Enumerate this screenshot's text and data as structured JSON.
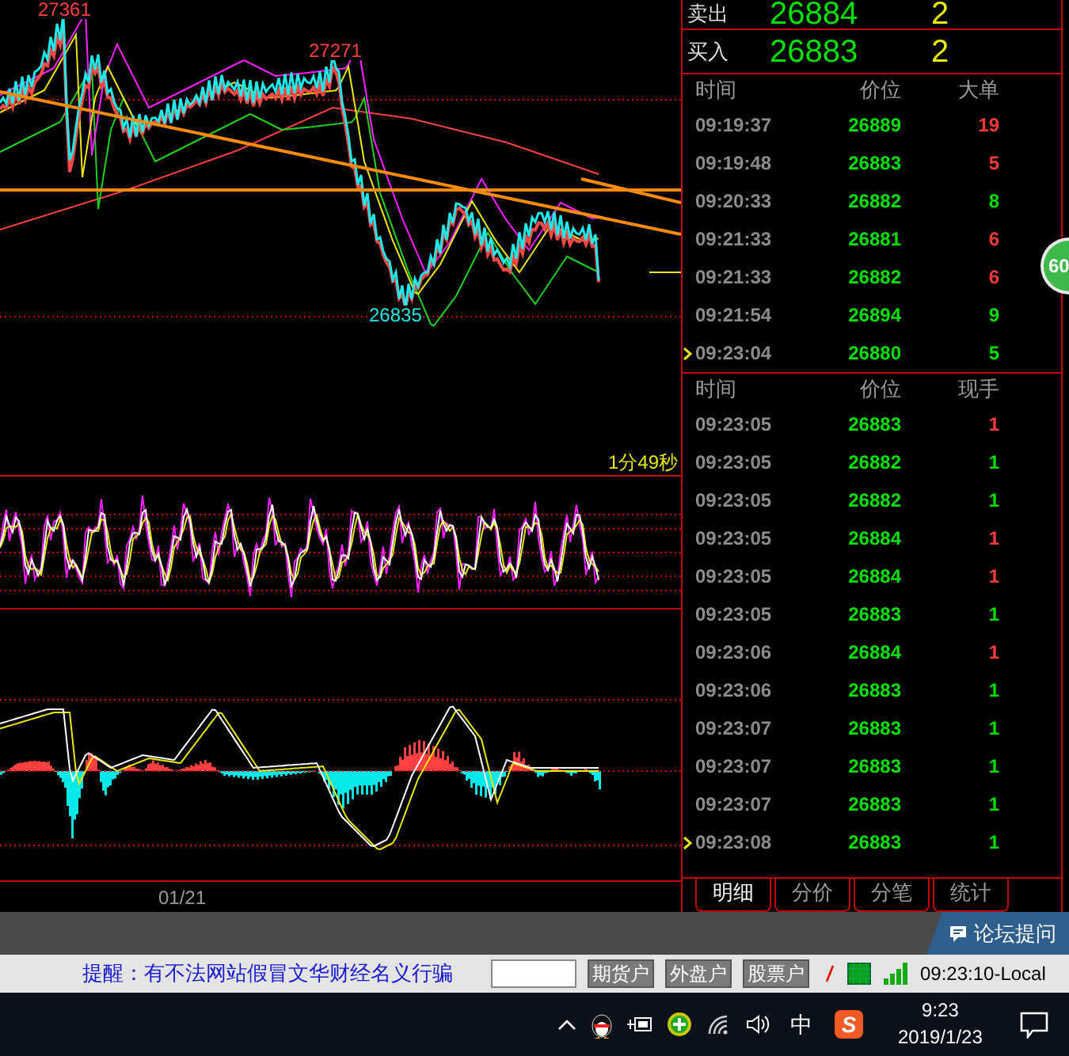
{
  "chart": {
    "labels": [
      {
        "kind": "high",
        "text": "27361"
      },
      {
        "kind": "peak",
        "text": "27271"
      },
      {
        "kind": "low",
        "text": "26835"
      }
    ],
    "timer": "1分49秒"
  },
  "date_label": "01/21",
  "quote": {
    "sell": {
      "label": "卖出",
      "price": "26884",
      "volume": "2"
    },
    "buy": {
      "label": "买入",
      "price": "26883",
      "volume": "2"
    }
  },
  "big_orders": {
    "columns": [
      "时间",
      "价位",
      "大单"
    ],
    "rows": [
      {
        "time": "09:19:37",
        "price": "26889",
        "quantity": "19",
        "color": "#ff3b3b",
        "marked": false
      },
      {
        "time": "09:19:48",
        "price": "26883",
        "quantity": "5",
        "color": "#ff3b3b",
        "marked": false
      },
      {
        "time": "09:20:33",
        "price": "26882",
        "quantity": "8",
        "color": "#00e000",
        "marked": false
      },
      {
        "time": "09:21:33",
        "price": "26881",
        "quantity": "6",
        "color": "#ff3b3b",
        "marked": false
      },
      {
        "time": "09:21:33",
        "price": "26882",
        "quantity": "6",
        "color": "#ff3b3b",
        "marked": false
      },
      {
        "time": "09:21:54",
        "price": "26894",
        "quantity": "9",
        "color": "#00e000",
        "marked": false
      },
      {
        "time": "09:23:04",
        "price": "26880",
        "quantity": "5",
        "color": "#00e000",
        "marked": true
      }
    ]
  },
  "ticks": {
    "columns": [
      "时间",
      "价位",
      "现手"
    ],
    "rows": [
      {
        "time": "09:23:05",
        "price": "26883",
        "quantity": "1",
        "color": "#ff3b3b",
        "marked": false
      },
      {
        "time": "09:23:05",
        "price": "26882",
        "quantity": "1",
        "color": "#00e000",
        "marked": false
      },
      {
        "time": "09:23:05",
        "price": "26882",
        "quantity": "1",
        "color": "#00e000",
        "marked": false
      },
      {
        "time": "09:23:05",
        "price": "26884",
        "quantity": "1",
        "color": "#ff3b3b",
        "marked": false
      },
      {
        "time": "09:23:05",
        "price": "26884",
        "quantity": "1",
        "color": "#ff3b3b",
        "marked": false
      },
      {
        "time": "09:23:05",
        "price": "26883",
        "quantity": "1",
        "color": "#00e000",
        "marked": false
      },
      {
        "time": "09:23:06",
        "price": "26884",
        "quantity": "1",
        "color": "#ff3b3b",
        "marked": false
      },
      {
        "time": "09:23:06",
        "price": "26883",
        "quantity": "1",
        "color": "#00e000",
        "marked": false
      },
      {
        "time": "09:23:07",
        "price": "26883",
        "quantity": "1",
        "color": "#00e000",
        "marked": false
      },
      {
        "time": "09:23:07",
        "price": "26883",
        "quantity": "1",
        "color": "#00e000",
        "marked": false
      },
      {
        "time": "09:23:07",
        "price": "26883",
        "quantity": "1",
        "color": "#00e000",
        "marked": false
      },
      {
        "time": "09:23:08",
        "price": "26883",
        "quantity": "1",
        "color": "#00e000",
        "marked": true
      }
    ]
  },
  "tabs": [
    {
      "label": "明细",
      "selected": true
    },
    {
      "label": "分价",
      "selected": false
    },
    {
      "label": "分笔",
      "selected": false
    },
    {
      "label": "统计",
      "selected": false
    }
  ],
  "badge": "60",
  "forum_button": "论坛提问",
  "status_bar": {
    "notice": "提醒：有不法网站假冒文华财经名义行骗",
    "buttons": [
      "期货户",
      "外盘户",
      "股票户"
    ],
    "time": "09:23:10-Local"
  },
  "taskbar": {
    "ime": "中",
    "ime_logo": "S",
    "time": "9:23",
    "date": "2019/1/23"
  }
}
